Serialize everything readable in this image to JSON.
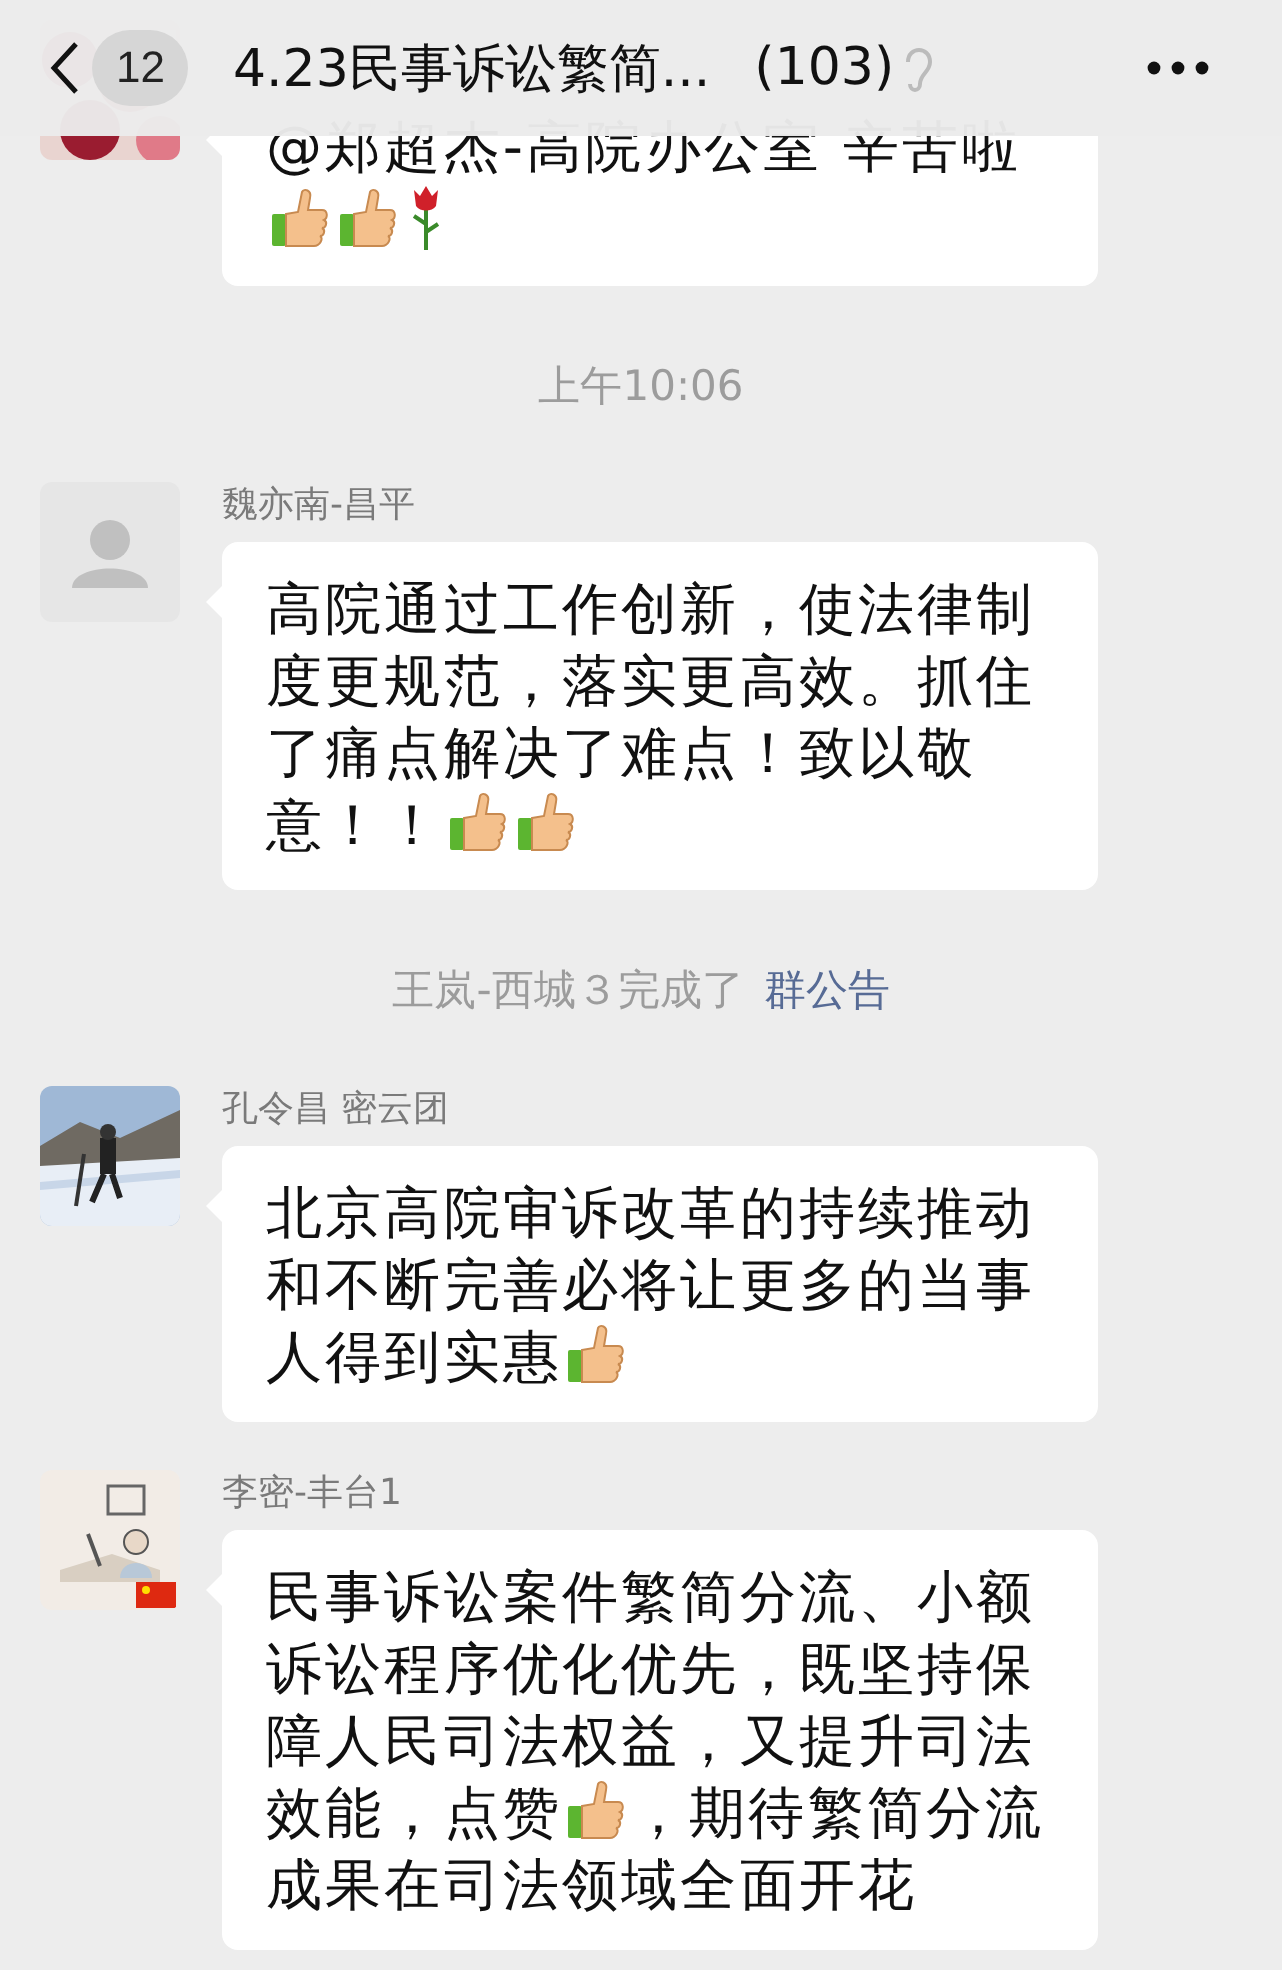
{
  "header": {
    "back_count": "12",
    "title": "4.23民事诉讼繁简...",
    "member_count": "(103)"
  },
  "items": [
    {
      "kind": "message",
      "avatar": {
        "kind": "picture"
      },
      "parts": [
        {
          "kind": "text",
          "text": "@郑超杰-高院办公室 辛苦啦"
        },
        {
          "kind": "thumbs"
        },
        {
          "kind": "thumbs"
        },
        {
          "kind": "rose"
        }
      ]
    },
    {
      "kind": "time",
      "text": "上午10:06"
    },
    {
      "kind": "message",
      "sender": "魏亦南-昌平",
      "avatar": {
        "kind": "placeholder"
      },
      "parts": [
        {
          "kind": "text",
          "text": "高院通过工作创新，使法律制度更规范，落实更高效。抓住了痛点解决了难点！致以敬意！！"
        },
        {
          "kind": "thumbs"
        },
        {
          "kind": "thumbs"
        }
      ]
    },
    {
      "kind": "notice",
      "text": "王岚-西城３完成了",
      "link": "群公告"
    },
    {
      "kind": "message",
      "sender": "孔令昌 密云团",
      "avatar": {
        "kind": "picture"
      },
      "parts": [
        {
          "kind": "text",
          "text": "北京高院审诉改革的持续推动和不断完善必将让更多的当事人得到实惠"
        },
        {
          "kind": "thumbs"
        }
      ]
    },
    {
      "kind": "message",
      "sender": "李密-丰台1",
      "avatar": {
        "kind": "picture"
      },
      "parts": [
        {
          "kind": "text",
          "text": "民事诉讼案件繁简分流、小额诉讼程序优化优先，既坚持保障人民司法权益，又提升司法效能，点赞"
        },
        {
          "kind": "thumbs"
        },
        {
          "kind": "text",
          "text": "，期待繁简分流成果在司法领域全面开花"
        }
      ]
    }
  ]
}
